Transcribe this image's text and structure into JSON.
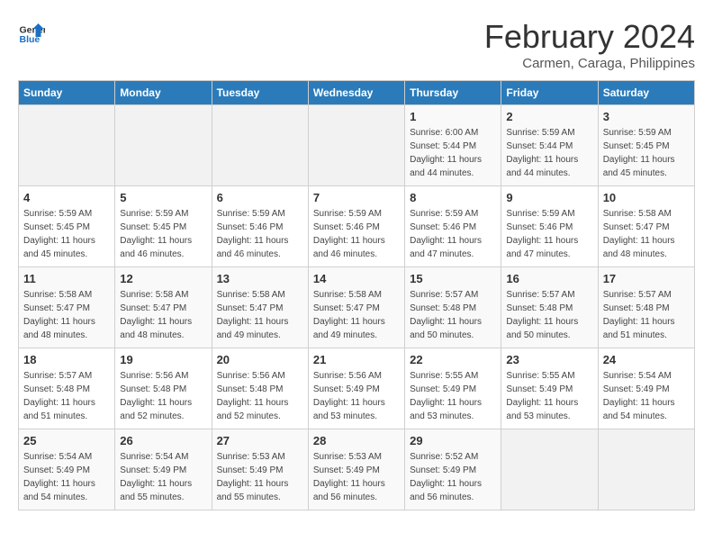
{
  "header": {
    "logo_general": "General",
    "logo_blue": "Blue",
    "month_title": "February 2024",
    "subtitle": "Carmen, Caraga, Philippines"
  },
  "days_of_week": [
    "Sunday",
    "Monday",
    "Tuesday",
    "Wednesday",
    "Thursday",
    "Friday",
    "Saturday"
  ],
  "weeks": [
    [
      {
        "day": "",
        "info": ""
      },
      {
        "day": "",
        "info": ""
      },
      {
        "day": "",
        "info": ""
      },
      {
        "day": "",
        "info": ""
      },
      {
        "day": "1",
        "info": "Sunrise: 6:00 AM\nSunset: 5:44 PM\nDaylight: 11 hours\nand 44 minutes."
      },
      {
        "day": "2",
        "info": "Sunrise: 5:59 AM\nSunset: 5:44 PM\nDaylight: 11 hours\nand 44 minutes."
      },
      {
        "day": "3",
        "info": "Sunrise: 5:59 AM\nSunset: 5:45 PM\nDaylight: 11 hours\nand 45 minutes."
      }
    ],
    [
      {
        "day": "4",
        "info": "Sunrise: 5:59 AM\nSunset: 5:45 PM\nDaylight: 11 hours\nand 45 minutes."
      },
      {
        "day": "5",
        "info": "Sunrise: 5:59 AM\nSunset: 5:45 PM\nDaylight: 11 hours\nand 46 minutes."
      },
      {
        "day": "6",
        "info": "Sunrise: 5:59 AM\nSunset: 5:46 PM\nDaylight: 11 hours\nand 46 minutes."
      },
      {
        "day": "7",
        "info": "Sunrise: 5:59 AM\nSunset: 5:46 PM\nDaylight: 11 hours\nand 46 minutes."
      },
      {
        "day": "8",
        "info": "Sunrise: 5:59 AM\nSunset: 5:46 PM\nDaylight: 11 hours\nand 47 minutes."
      },
      {
        "day": "9",
        "info": "Sunrise: 5:59 AM\nSunset: 5:46 PM\nDaylight: 11 hours\nand 47 minutes."
      },
      {
        "day": "10",
        "info": "Sunrise: 5:58 AM\nSunset: 5:47 PM\nDaylight: 11 hours\nand 48 minutes."
      }
    ],
    [
      {
        "day": "11",
        "info": "Sunrise: 5:58 AM\nSunset: 5:47 PM\nDaylight: 11 hours\nand 48 minutes."
      },
      {
        "day": "12",
        "info": "Sunrise: 5:58 AM\nSunset: 5:47 PM\nDaylight: 11 hours\nand 48 minutes."
      },
      {
        "day": "13",
        "info": "Sunrise: 5:58 AM\nSunset: 5:47 PM\nDaylight: 11 hours\nand 49 minutes."
      },
      {
        "day": "14",
        "info": "Sunrise: 5:58 AM\nSunset: 5:47 PM\nDaylight: 11 hours\nand 49 minutes."
      },
      {
        "day": "15",
        "info": "Sunrise: 5:57 AM\nSunset: 5:48 PM\nDaylight: 11 hours\nand 50 minutes."
      },
      {
        "day": "16",
        "info": "Sunrise: 5:57 AM\nSunset: 5:48 PM\nDaylight: 11 hours\nand 50 minutes."
      },
      {
        "day": "17",
        "info": "Sunrise: 5:57 AM\nSunset: 5:48 PM\nDaylight: 11 hours\nand 51 minutes."
      }
    ],
    [
      {
        "day": "18",
        "info": "Sunrise: 5:57 AM\nSunset: 5:48 PM\nDaylight: 11 hours\nand 51 minutes."
      },
      {
        "day": "19",
        "info": "Sunrise: 5:56 AM\nSunset: 5:48 PM\nDaylight: 11 hours\nand 52 minutes."
      },
      {
        "day": "20",
        "info": "Sunrise: 5:56 AM\nSunset: 5:48 PM\nDaylight: 11 hours\nand 52 minutes."
      },
      {
        "day": "21",
        "info": "Sunrise: 5:56 AM\nSunset: 5:49 PM\nDaylight: 11 hours\nand 53 minutes."
      },
      {
        "day": "22",
        "info": "Sunrise: 5:55 AM\nSunset: 5:49 PM\nDaylight: 11 hours\nand 53 minutes."
      },
      {
        "day": "23",
        "info": "Sunrise: 5:55 AM\nSunset: 5:49 PM\nDaylight: 11 hours\nand 53 minutes."
      },
      {
        "day": "24",
        "info": "Sunrise: 5:54 AM\nSunset: 5:49 PM\nDaylight: 11 hours\nand 54 minutes."
      }
    ],
    [
      {
        "day": "25",
        "info": "Sunrise: 5:54 AM\nSunset: 5:49 PM\nDaylight: 11 hours\nand 54 minutes."
      },
      {
        "day": "26",
        "info": "Sunrise: 5:54 AM\nSunset: 5:49 PM\nDaylight: 11 hours\nand 55 minutes."
      },
      {
        "day": "27",
        "info": "Sunrise: 5:53 AM\nSunset: 5:49 PM\nDaylight: 11 hours\nand 55 minutes."
      },
      {
        "day": "28",
        "info": "Sunrise: 5:53 AM\nSunset: 5:49 PM\nDaylight: 11 hours\nand 56 minutes."
      },
      {
        "day": "29",
        "info": "Sunrise: 5:52 AM\nSunset: 5:49 PM\nDaylight: 11 hours\nand 56 minutes."
      },
      {
        "day": "",
        "info": ""
      },
      {
        "day": "",
        "info": ""
      }
    ]
  ]
}
